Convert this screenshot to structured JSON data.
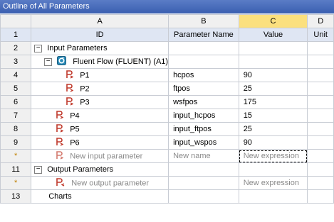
{
  "window": {
    "title": "Outline of All Parameters"
  },
  "columns": [
    "A",
    "B",
    "C",
    "D"
  ],
  "headers": {
    "id": "ID",
    "param_name": "Parameter Name",
    "value": "Value",
    "unit": "Unit"
  },
  "row_numbers": [
    "1",
    "2",
    "3",
    "4",
    "5",
    "6",
    "7",
    "8",
    "9",
    "*",
    "11",
    "*",
    "13"
  ],
  "rows": {
    "input_group": "Input Parameters",
    "fluent": "Fluent Flow (FLUENT) (A1)",
    "p1": {
      "id": "P1",
      "name": "hcpos",
      "value": "90"
    },
    "p2": {
      "id": "P2",
      "name": "ftpos",
      "value": "25"
    },
    "p3": {
      "id": "P3",
      "name": "wsfpos",
      "value": "175"
    },
    "p4": {
      "id": "P4",
      "name": "input_hcpos",
      "value": "15"
    },
    "p5": {
      "id": "P5",
      "name": "input_ftpos",
      "value": "25"
    },
    "p6": {
      "id": "P6",
      "name": "input_wspos",
      "value": "90"
    },
    "new_input": {
      "id": "New input parameter",
      "name": "New name",
      "value": "New expression"
    },
    "output_group": "Output Parameters",
    "new_output": {
      "id": "New output parameter",
      "value": "New expression"
    },
    "charts": "Charts"
  },
  "colors": {
    "accent": "#3a5fb0",
    "selected_column": "#fbe07e",
    "param_icon": "#c0392b"
  }
}
